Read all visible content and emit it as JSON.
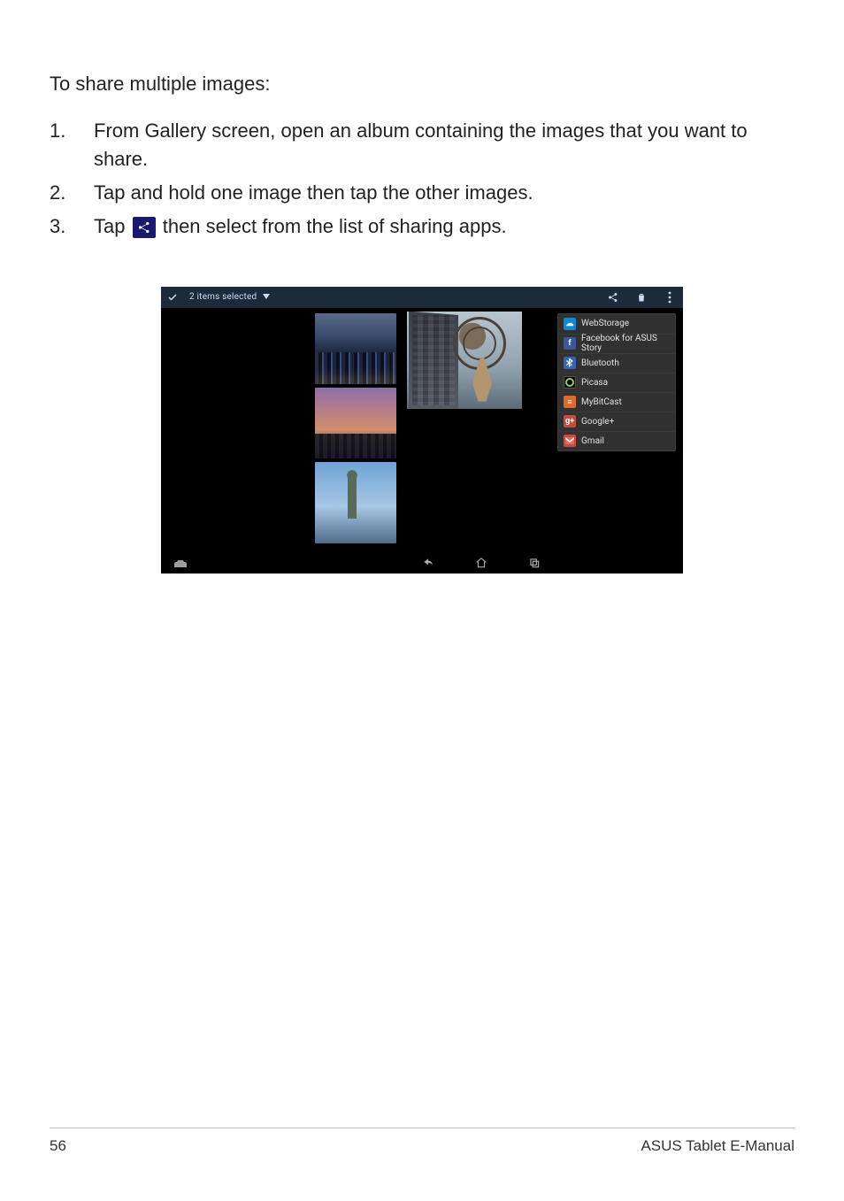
{
  "intro": "To share multiple images:",
  "steps": [
    "From Gallery screen, open an album containing the images that you want to share.",
    "Tap and hold one image then tap the other images.",
    {
      "pre": "Tap ",
      "post": " then select from the list of sharing apps."
    }
  ],
  "screenshot": {
    "topbar": {
      "selected_text": "2 items selected"
    },
    "share_menu": [
      "WebStorage",
      "Facebook for ASUS Story",
      "Bluetooth",
      "Picasa",
      "MyBitCast",
      "Google+",
      "Gmail"
    ]
  },
  "footer": {
    "page_number": "56",
    "doc_title": "ASUS Tablet E-Manual"
  }
}
